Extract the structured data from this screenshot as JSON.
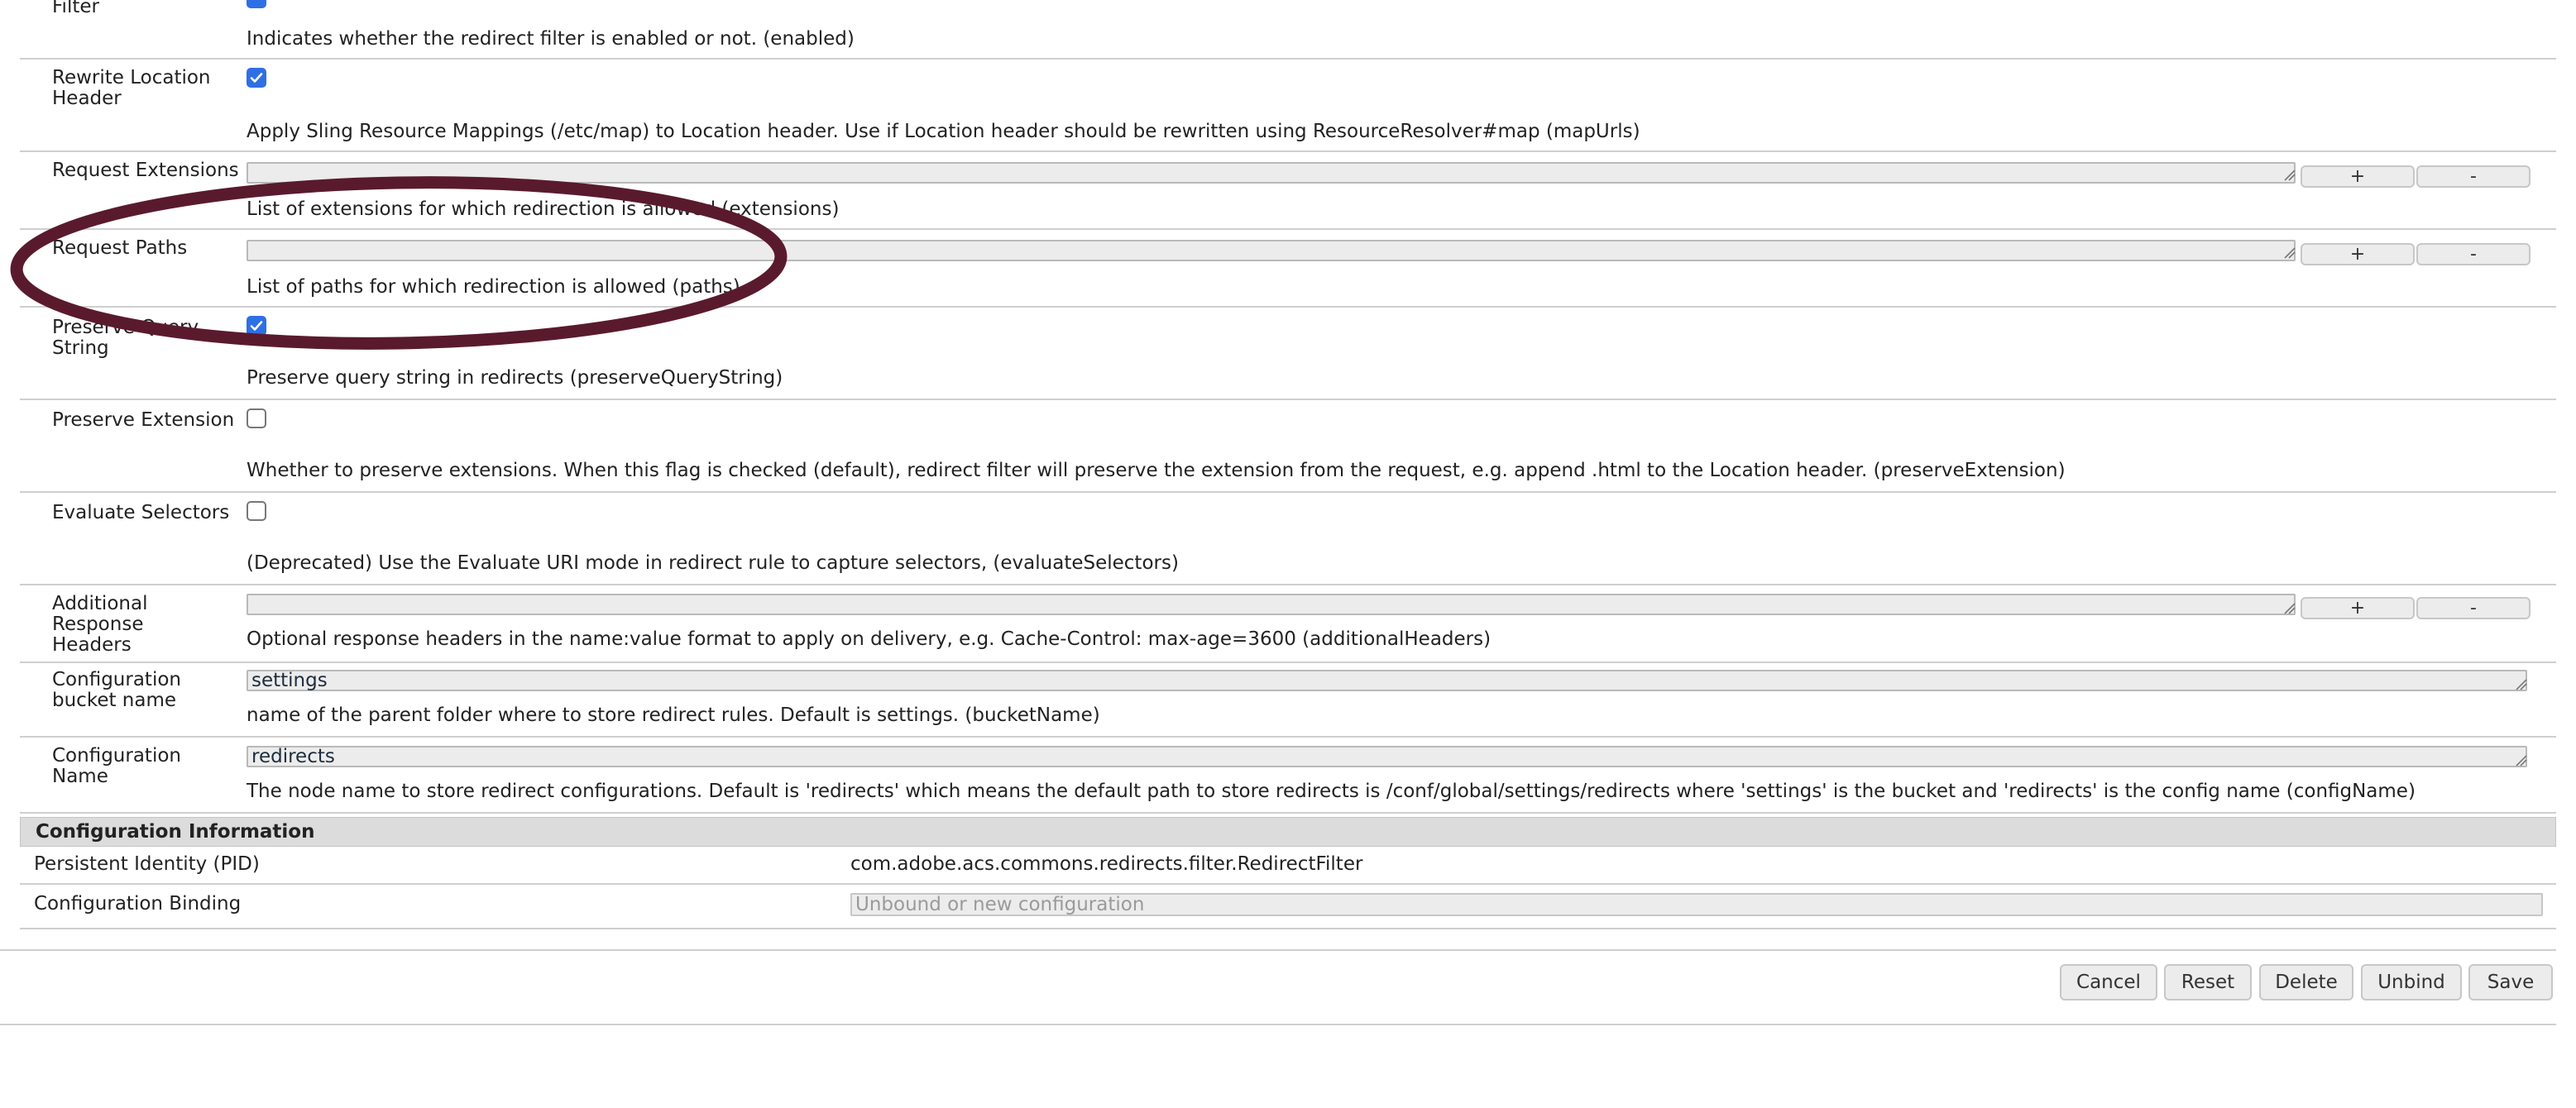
{
  "fields": [
    {
      "label": "Filter",
      "description": "Indicates whether the redirect filter is enabled or not. (enabled)"
    },
    {
      "label": "Rewrite Location Header",
      "checked": true,
      "description": "Apply Sling Resource Mappings (/etc/map) to Location header. Use if Location header should be rewritten using ResourceResolver#map (mapUrls)"
    },
    {
      "label": "Request Extensions",
      "value": "",
      "description": "List of extensions for which redirection is allowed (extensions)"
    },
    {
      "label": "Request Paths",
      "value": "",
      "description": "List of paths for which redirection is allowed (paths)"
    },
    {
      "label": "Preserve Query String",
      "checked": true,
      "description": "Preserve query string in redirects (preserveQueryString)"
    },
    {
      "label": "Preserve Extension",
      "checked": false,
      "description": "Whether to preserve extensions. When this flag is checked (default), redirect filter will preserve the extension from the request, e.g. append .html to the Location header. (preserveExtension)"
    },
    {
      "label": "Evaluate Selectors",
      "checked": false,
      "description": "(Deprecated) Use the Evaluate URI mode in redirect rule to capture selectors, (evaluateSelectors)"
    },
    {
      "label": "Additional Response Headers",
      "value": "",
      "description": "Optional response headers in the name:value format to apply on delivery, e.g. Cache-Control: max-age=3600 (additionalHeaders)"
    },
    {
      "label": "Configuration bucket name",
      "value": "settings",
      "description": "name of the parent folder where to store redirect rules. Default is settings. (bucketName)"
    },
    {
      "label": "Configuration Name",
      "value": "redirects",
      "description": "The node name to store redirect configurations. Default is 'redirects' which means the default path to store redirects is /conf/global/settings/redirects where 'settings' is the bucket and 'redirects' is the config name (configName)"
    }
  ],
  "multi_buttons": {
    "add": "+",
    "remove": "-"
  },
  "config_info": {
    "title": "Configuration Information",
    "pid_label": "Persistent Identity (PID)",
    "pid_value": "com.adobe.acs.commons.redirects.filter.RedirectFilter",
    "binding_label": "Configuration Binding",
    "binding_placeholder": "Unbound or new configuration"
  },
  "actions": {
    "cancel": "Cancel",
    "reset": "Reset",
    "delete": "Delete",
    "unbind": "Unbind",
    "save": "Save"
  },
  "colors": {
    "checkbox_checked": "#2f6fe5",
    "annotation_ellipse": "#5a1a2e",
    "section_bg": "#dcdcdc"
  },
  "icons": {
    "checked": "checkmark-icon",
    "resize": "resize-grip-icon"
  }
}
